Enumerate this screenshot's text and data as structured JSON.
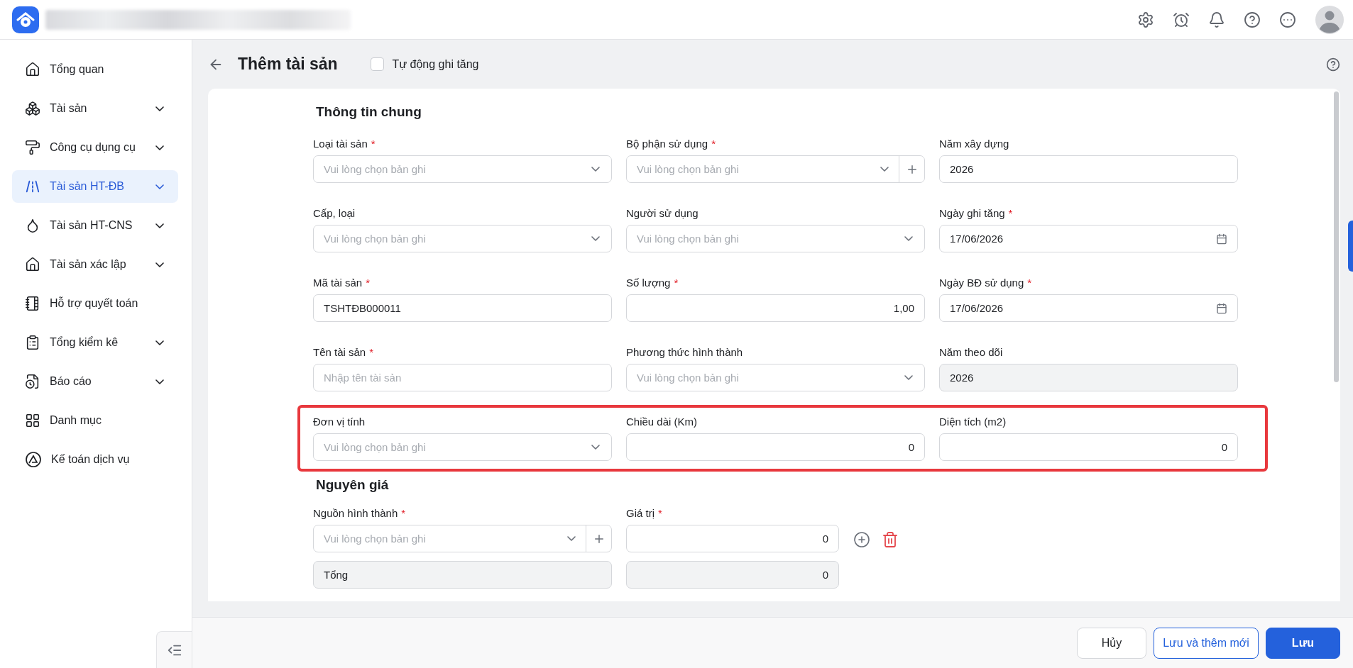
{
  "sidebar": {
    "items": [
      {
        "label": "Tổng quan",
        "expandable": false,
        "selected": false
      },
      {
        "label": "Tài sản",
        "expandable": true,
        "selected": false
      },
      {
        "label": "Công cụ dụng cụ",
        "expandable": true,
        "selected": false
      },
      {
        "label": "Tài sản HT-ĐB",
        "expandable": true,
        "selected": true
      },
      {
        "label": "Tài sản HT-CNS",
        "expandable": true,
        "selected": false
      },
      {
        "label": "Tài sản xác lập",
        "expandable": true,
        "selected": false
      },
      {
        "label": "Hỗ trợ quyết toán",
        "expandable": false,
        "selected": false
      },
      {
        "label": "Tổng kiểm kê",
        "expandable": true,
        "selected": false
      },
      {
        "label": "Báo cáo",
        "expandable": true,
        "selected": false
      },
      {
        "label": "Danh mục",
        "expandable": false,
        "selected": false
      },
      {
        "label": "Kế toán dịch vụ",
        "expandable": false,
        "selected": false
      }
    ]
  },
  "page": {
    "title": "Thêm tài sản",
    "auto_increase": {
      "label": "Tự động ghi tăng",
      "checked": false
    }
  },
  "general_info": {
    "title": "Thông tin chung",
    "rows": [
      {
        "highlighted": false,
        "fields": [
          {
            "kind": "select",
            "label": "Loại tài sản",
            "required_mark": "*",
            "placeholder": "Vui lòng chọn bản ghi"
          },
          {
            "kind": "select_add",
            "label": "Bộ phận sử dụng",
            "required_mark": "*",
            "placeholder": "Vui lòng chọn bản ghi"
          },
          {
            "kind": "text",
            "label": "Năm xây dựng",
            "value": "2026"
          }
        ]
      },
      {
        "highlighted": false,
        "fields": [
          {
            "kind": "select",
            "label": "Cấp, loại",
            "placeholder": "Vui lòng chọn bản ghi"
          },
          {
            "kind": "select",
            "label": "Người sử dụng",
            "placeholder": "Vui lòng chọn bản ghi"
          },
          {
            "kind": "date",
            "label": "Ngày ghi tăng",
            "required_mark": "*",
            "value": "17/06/2026"
          }
        ]
      },
      {
        "highlighted": false,
        "fields": [
          {
            "kind": "text",
            "label": "Mã tài sản",
            "required_mark": "*",
            "value": "TSHTĐB000011"
          },
          {
            "kind": "number",
            "label": "Số lượng",
            "required_mark": "*",
            "value": "1,00"
          },
          {
            "kind": "date",
            "label": "Ngày BĐ sử dụng",
            "required_mark": "*",
            "value": "17/06/2026"
          }
        ]
      },
      {
        "highlighted": false,
        "fields": [
          {
            "kind": "text",
            "label": "Tên tài sản",
            "required_mark": "*",
            "placeholder": "Nhập tên tài sản"
          },
          {
            "kind": "select",
            "label": "Phương thức hình thành",
            "placeholder": "Vui lòng chọn bản ghi"
          },
          {
            "kind": "readonly",
            "label": "Năm theo dõi",
            "value": "2026"
          }
        ]
      },
      {
        "highlighted": true,
        "fields": [
          {
            "kind": "select",
            "label": "Đơn vị tính",
            "placeholder": "Vui lòng chọn bản ghi"
          },
          {
            "kind": "number",
            "label": "Chiều dài (Km)",
            "value": "0"
          },
          {
            "kind": "number",
            "label": "Diện tích (m2)",
            "value": "0"
          }
        ]
      }
    ]
  },
  "original_cost": {
    "title": "Nguyên giá",
    "source": {
      "kind": "select_add",
      "label": "Nguồn hình thành",
      "required_mark": "*",
      "placeholder": "Vui lòng chọn bản ghi"
    },
    "amount": {
      "kind": "number",
      "label": "Giá trị",
      "required_mark": "*",
      "value": "0"
    },
    "total": {
      "label": "Tổng",
      "value": "0"
    }
  },
  "footer": {
    "buttons": [
      {
        "label": "Hủy",
        "kind": "secondary"
      },
      {
        "label": "Lưu và thêm mới",
        "kind": "outline"
      },
      {
        "label": "Lưu",
        "kind": "primary"
      }
    ]
  }
}
